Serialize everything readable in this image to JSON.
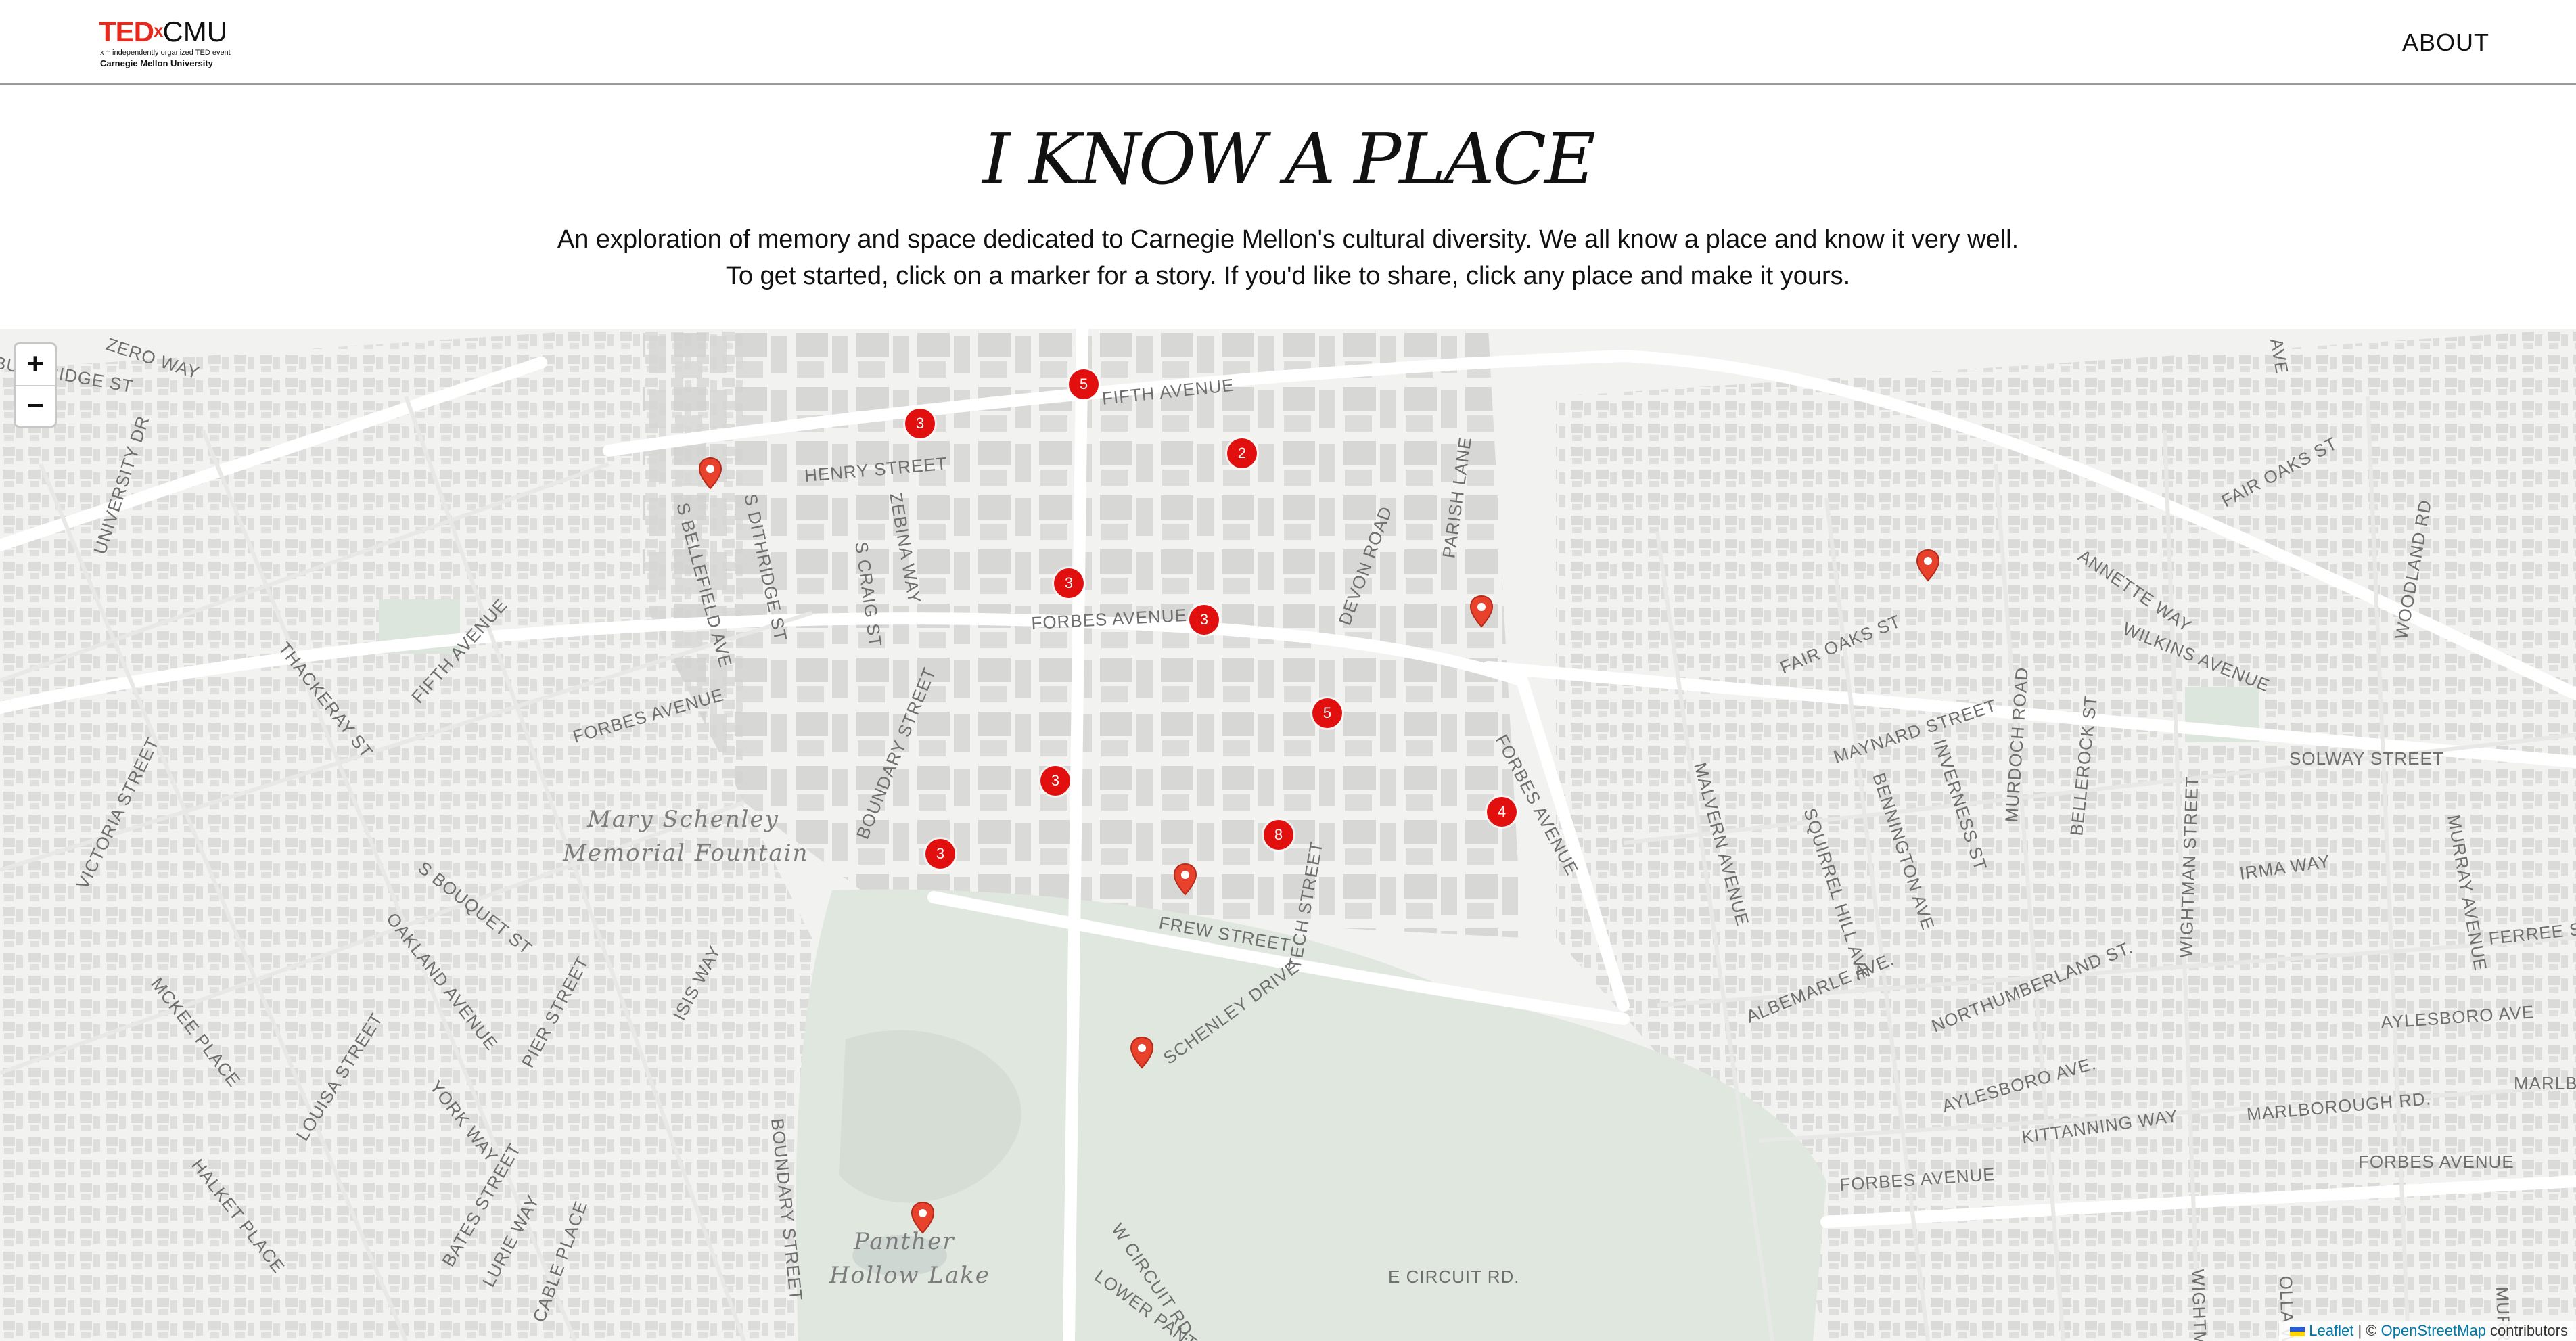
{
  "header": {
    "logo": {
      "ted": "TED",
      "x": "x",
      "cmu": "CMU",
      "tagline": "x = independently organized TED event",
      "university": "Carnegie Mellon University"
    },
    "about_label": "ABOUT"
  },
  "hero": {
    "title": "I KNOW A PLACE",
    "description_line1": "An exploration of memory and space dedicated to Carnegie Mellon's cultural diversity. We all know a place and know it very well.",
    "description_line2": "To get started, click on a marker for a story. If you'd like to share, click any place and make it yours."
  },
  "map": {
    "zoom_in_label": "+",
    "zoom_out_label": "−",
    "accent_color": "#e20f0f",
    "clusters": [
      {
        "count": "5"
      },
      {
        "count": "3"
      },
      {
        "count": "2"
      },
      {
        "count": "3"
      },
      {
        "count": "3"
      },
      {
        "count": "5"
      },
      {
        "count": "3"
      },
      {
        "count": "3"
      },
      {
        "count": "8"
      },
      {
        "count": "4"
      }
    ],
    "pins": [
      "map-pin-icon",
      "map-pin-icon",
      "map-pin-icon",
      "map-pin-icon",
      "map-pin-icon",
      "map-pin-icon"
    ],
    "labels": {
      "zero_way": "ZERO WAY",
      "burnridge": "BURNRIDGE ST",
      "fifth_ave_n": "FIFTH AVENUE",
      "henry": "HENRY STREET",
      "ditridge": "S DITHRIDGE ST",
      "zebina": "ZEBINA WAY",
      "bellefield": "S BELLEFIELD AVE",
      "craig": "S CRAIG ST",
      "parish": "PARISH LANE",
      "devon": "DEVON ROAD",
      "university_dr": "UNIVERSITY DR",
      "forbes_center": "FORBES AVENUE",
      "forbes_west": "FORBES AVENUE",
      "fifth_ave_w": "FIFTH AVENUE",
      "thackeray": "THACKERAY ST",
      "fountain1": "Mary Schenley",
      "fountain2": "Memorial Fountain",
      "boundary_n": "BOUNDARY STREET",
      "victoria": "VICTORIA STREET",
      "bouquet": "S BOUQUET ST",
      "oakland": "OAKLAND AVENUE",
      "mckee": "MCKEE PLACE",
      "isis": "ISIS WAY",
      "pier": "PIER STREET",
      "louisa": "LOUISA STREET",
      "york": "YORK WAY",
      "halket": "HALKET PLACE",
      "bates": "BATES STREET",
      "lurie": "LURIE WAY",
      "cable": "CABLE PLACE",
      "boundary_s": "BOUNDARY STREET",
      "frew": "FREW STREET",
      "tech": "TECH STREET",
      "schenley": "SCHENLEY DRIVE",
      "forbes_se": "FORBES AVENUE",
      "panther1": "Panther",
      "panther2": "Hollow Lake",
      "w_circuit": "W CIRCUIT RD.",
      "e_circuit": "E CIRCUIT RD.",
      "lower_panther": "LOWER PANTHER",
      "fair_oaks_w": "FAIR OAKS ST",
      "fair_oaks_e": "FAIR OAKS ST",
      "annette": "ANNETTE WAY",
      "wilkins": "WILKINS AVENUE",
      "woodland": "WOODLAND RD",
      "maynard": "MAYNARD STREET",
      "malvern": "MALVERN AVENUE",
      "squirrel": "SQUIRREL HILL AVE",
      "bennington": "BENNINGTON AVE",
      "inverness": "INVERNESS ST",
      "murdoch": "MURDOCH ROAD",
      "bellerock": "BELLEROCK ST",
      "solway": "SOLWAY STREET",
      "wightman_n": "WIGHTMAN STREET",
      "murray": "MURRAY AVENUE",
      "irma": "IRMA WAY",
      "ferree": "FERREE STREET",
      "albemarle": "ALBEMARLE AVE.",
      "northumberland": "NORTHUMBERLAND ST.",
      "aylesboro_w": "AYLESBORO AVE.",
      "aylesboro_e": "AYLESBORO AVE",
      "kittanning": "KITTANNING WAY",
      "marlborough": "MARLBOROUGH RD.",
      "marlb2": "MARLB",
      "forbes_east1": "FORBES AVENUE",
      "forbes_east2": "FORBES AVENUE",
      "wightman_s": "WIGHTMAN",
      "olla": "OLLA WAY",
      "murr": "MURR",
      "ave_top": "AVE"
    },
    "attribution": {
      "leaflet": "Leaflet",
      "sep": " | © ",
      "osm": "OpenStreetMap",
      "rest": " contributors"
    }
  }
}
